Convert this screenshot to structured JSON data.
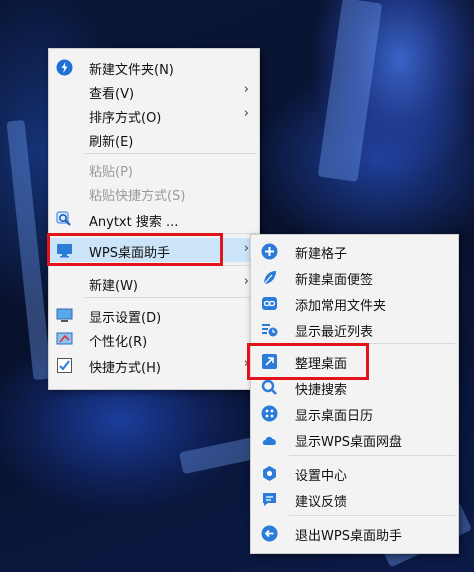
{
  "context_menu": {
    "items": [
      {
        "label": "新建文件夹(N)",
        "icon": "new-folder-icon"
      },
      {
        "label": "查看(V)",
        "has_submenu": true
      },
      {
        "label": "排序方式(O)",
        "has_submenu": true
      },
      {
        "label": "刷新(E)"
      },
      {
        "label": "粘贴(P)",
        "disabled": true
      },
      {
        "label": "粘贴快捷方式(S)",
        "disabled": true
      },
      {
        "label": "Anytxt 搜索 ...",
        "icon": "search-icon"
      },
      {
        "label": "WPS桌面助手",
        "icon": "monitor-icon",
        "has_submenu": true,
        "highlighted": true
      },
      {
        "label": "新建(W)",
        "has_submenu": true
      },
      {
        "label": "显示设置(D)",
        "icon": "display-icon"
      },
      {
        "label": "个性化(R)",
        "icon": "personalize-icon"
      },
      {
        "label": "快捷方式(H)",
        "icon": "checkbox-icon",
        "has_submenu": true
      }
    ]
  },
  "submenu": {
    "title": "WPS桌面助手",
    "items": [
      {
        "label": "新建格子",
        "icon": "plus-circle-icon"
      },
      {
        "label": "新建桌面便签",
        "icon": "leaf-note-icon"
      },
      {
        "label": "添加常用文件夹",
        "icon": "link-folder-icon"
      },
      {
        "label": "显示最近列表",
        "icon": "recent-list-icon"
      },
      {
        "label": "整理桌面",
        "icon": "organize-arrow-icon",
        "highlighted": true
      },
      {
        "label": "快捷搜索",
        "icon": "search-icon"
      },
      {
        "label": "显示桌面日历",
        "icon": "calendar-dots-icon"
      },
      {
        "label": "显示WPS桌面网盘",
        "icon": "cloud-icon"
      },
      {
        "label": "设置中心",
        "icon": "gear-icon"
      },
      {
        "label": "建议反馈",
        "icon": "feedback-icon"
      },
      {
        "label": "退出WPS桌面助手",
        "icon": "exit-arrow-icon"
      }
    ]
  },
  "colors": {
    "accent": "#2b7bd9",
    "highlight_box": "#e1141b",
    "hover": "#cce4f7"
  }
}
